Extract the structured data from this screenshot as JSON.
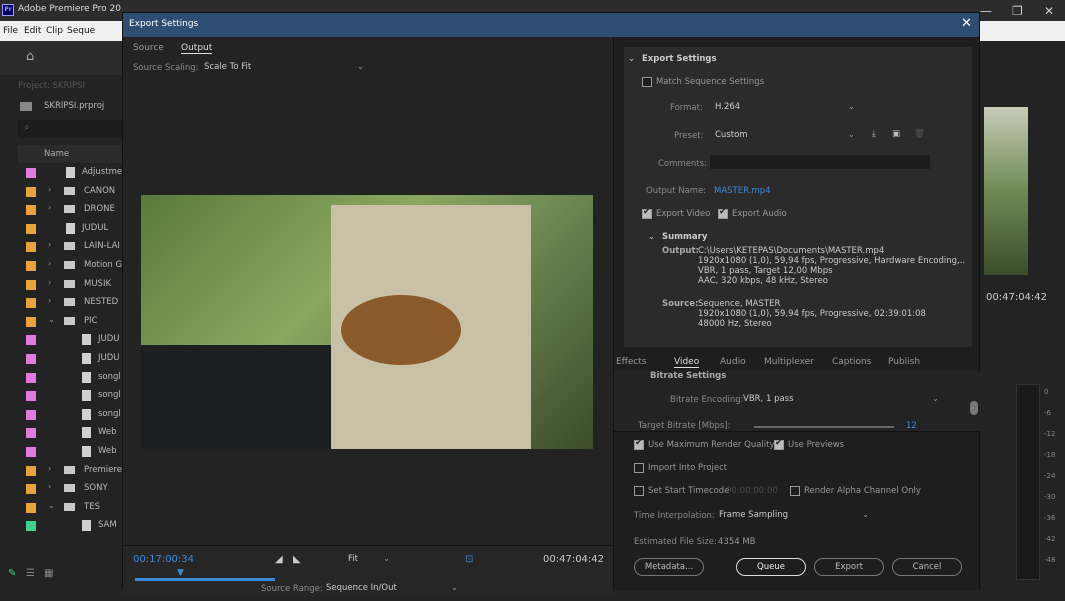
{
  "app": {
    "icon": "Pr",
    "title": "Adobe Premiere Pro 20"
  },
  "menu": [
    "File",
    "Edit",
    "Clip",
    "Seque"
  ],
  "window_controls": [
    "—",
    "❐",
    "✕"
  ],
  "project": {
    "tab": "Project: SKRIPSI",
    "file": "SKRIPSI.prproj",
    "column_name": "Name",
    "items": [
      {
        "label": "Adjustme",
        "color": "#e07ae0",
        "type": "file",
        "indent": 1
      },
      {
        "label": "CANON",
        "color": "#e8a33a",
        "type": "folder",
        "indent": 0
      },
      {
        "label": "DRONE",
        "color": "#e8a33a",
        "type": "folder",
        "indent": 0
      },
      {
        "label": "JUDUL",
        "color": "#e8a33a",
        "type": "file",
        "indent": 1
      },
      {
        "label": "LAIN-LAI",
        "color": "#e8a33a",
        "type": "folder",
        "indent": 0
      },
      {
        "label": "Motion G",
        "color": "#e8a33a",
        "type": "folder",
        "indent": 0
      },
      {
        "label": "MUSIK",
        "color": "#e8a33a",
        "type": "folder",
        "indent": 0
      },
      {
        "label": "NESTED",
        "color": "#e8a33a",
        "type": "folder",
        "indent": 0
      },
      {
        "label": "PIC",
        "color": "#e8a33a",
        "type": "folder-open",
        "indent": 0
      },
      {
        "label": "JUDU",
        "color": "#e07ae0",
        "type": "file",
        "indent": 2
      },
      {
        "label": "JUDU",
        "color": "#e07ae0",
        "type": "file",
        "indent": 2
      },
      {
        "label": "songl",
        "color": "#e07ae0",
        "type": "file",
        "indent": 2
      },
      {
        "label": "songl",
        "color": "#e07ae0",
        "type": "file",
        "indent": 2
      },
      {
        "label": "songl",
        "color": "#e07ae0",
        "type": "file",
        "indent": 2
      },
      {
        "label": "Web",
        "color": "#e07ae0",
        "type": "file",
        "indent": 2
      },
      {
        "label": "Web",
        "color": "#e07ae0",
        "type": "file",
        "indent": 2
      },
      {
        "label": "Premiere",
        "color": "#e8a33a",
        "type": "folder",
        "indent": 0
      },
      {
        "label": "SONY",
        "color": "#e8a33a",
        "type": "folder",
        "indent": 0
      },
      {
        "label": "TES",
        "color": "#e8a33a",
        "type": "folder-open",
        "indent": 0
      },
      {
        "label": "SAM",
        "color": "#3fcf8e",
        "type": "file",
        "indent": 2
      }
    ]
  },
  "dialog": {
    "title": "Export Settings",
    "tabs": [
      "Source",
      "Output"
    ],
    "source_scaling_label": "Source Scaling:",
    "source_scaling_value": "Scale To Fit",
    "current_time": "00:17:00:34",
    "fit": "Fit",
    "end_time": "00:47:04:42",
    "source_range_label": "Source Range:",
    "source_range_value": "Sequence In/Out",
    "settings": {
      "header": "Export Settings",
      "match_sequence": "Match Sequence Settings",
      "format_label": "Format:",
      "format_value": "H.264",
      "preset_label": "Preset:",
      "preset_value": "Custom",
      "comments_label": "Comments:",
      "output_name_label": "Output Name:",
      "output_name_value": "MASTER.mp4",
      "export_video": "Export Video",
      "export_audio": "Export Audio",
      "summary_header": "Summary",
      "output_label": "Output:",
      "output_lines": [
        "C:\\Users\\KETEPAS\\Documents\\MASTER.mp4",
        "1920x1080 (1,0), 59,94 fps, Progressive, Hardware Encoding,..",
        "VBR, 1 pass, Target 12,00 Mbps",
        "AAC, 320 kbps, 48 kHz, Stereo"
      ],
      "source_label": "Source:",
      "source_lines": [
        "Sequence, MASTER",
        "1920x1080 (1,0), 59,94 fps, Progressive, 02:39:01:08",
        "48000 Hz, Stereo"
      ]
    },
    "lower_tabs": [
      "Effects",
      "Video",
      "Audio",
      "Multiplexer",
      "Captions",
      "Publish"
    ],
    "bitrate_section": "Bitrate Settings",
    "bitrate_encoding_label": "Bitrate Encoding:",
    "bitrate_encoding_value": "VBR, 1 pass",
    "target_bitrate_label": "Target Bitrate [Mbps]:",
    "target_bitrate_value": "12",
    "use_max_render": "Use Maximum Render Quality",
    "use_previews": "Use Previews",
    "import_into_project": "Import Into Project",
    "set_start_timecode": "Set Start Timecode",
    "start_timecode_value": "00:00:00:00",
    "render_alpha": "Render Alpha Channel Only",
    "time_interp_label": "Time Interpolation:",
    "time_interp_value": "Frame Sampling",
    "est_size_label": "Estimated File Size:",
    "est_size_value": "4354 MB",
    "buttons": {
      "metadata": "Metadata...",
      "queue": "Queue",
      "export": "Export",
      "cancel": "Cancel"
    }
  },
  "right_panel": {
    "time": "00:47:04:42",
    "meter_ticks": [
      "0",
      "-6",
      "-12",
      "-18",
      "-24",
      "-30",
      "-36",
      "-42",
      "-48"
    ]
  }
}
